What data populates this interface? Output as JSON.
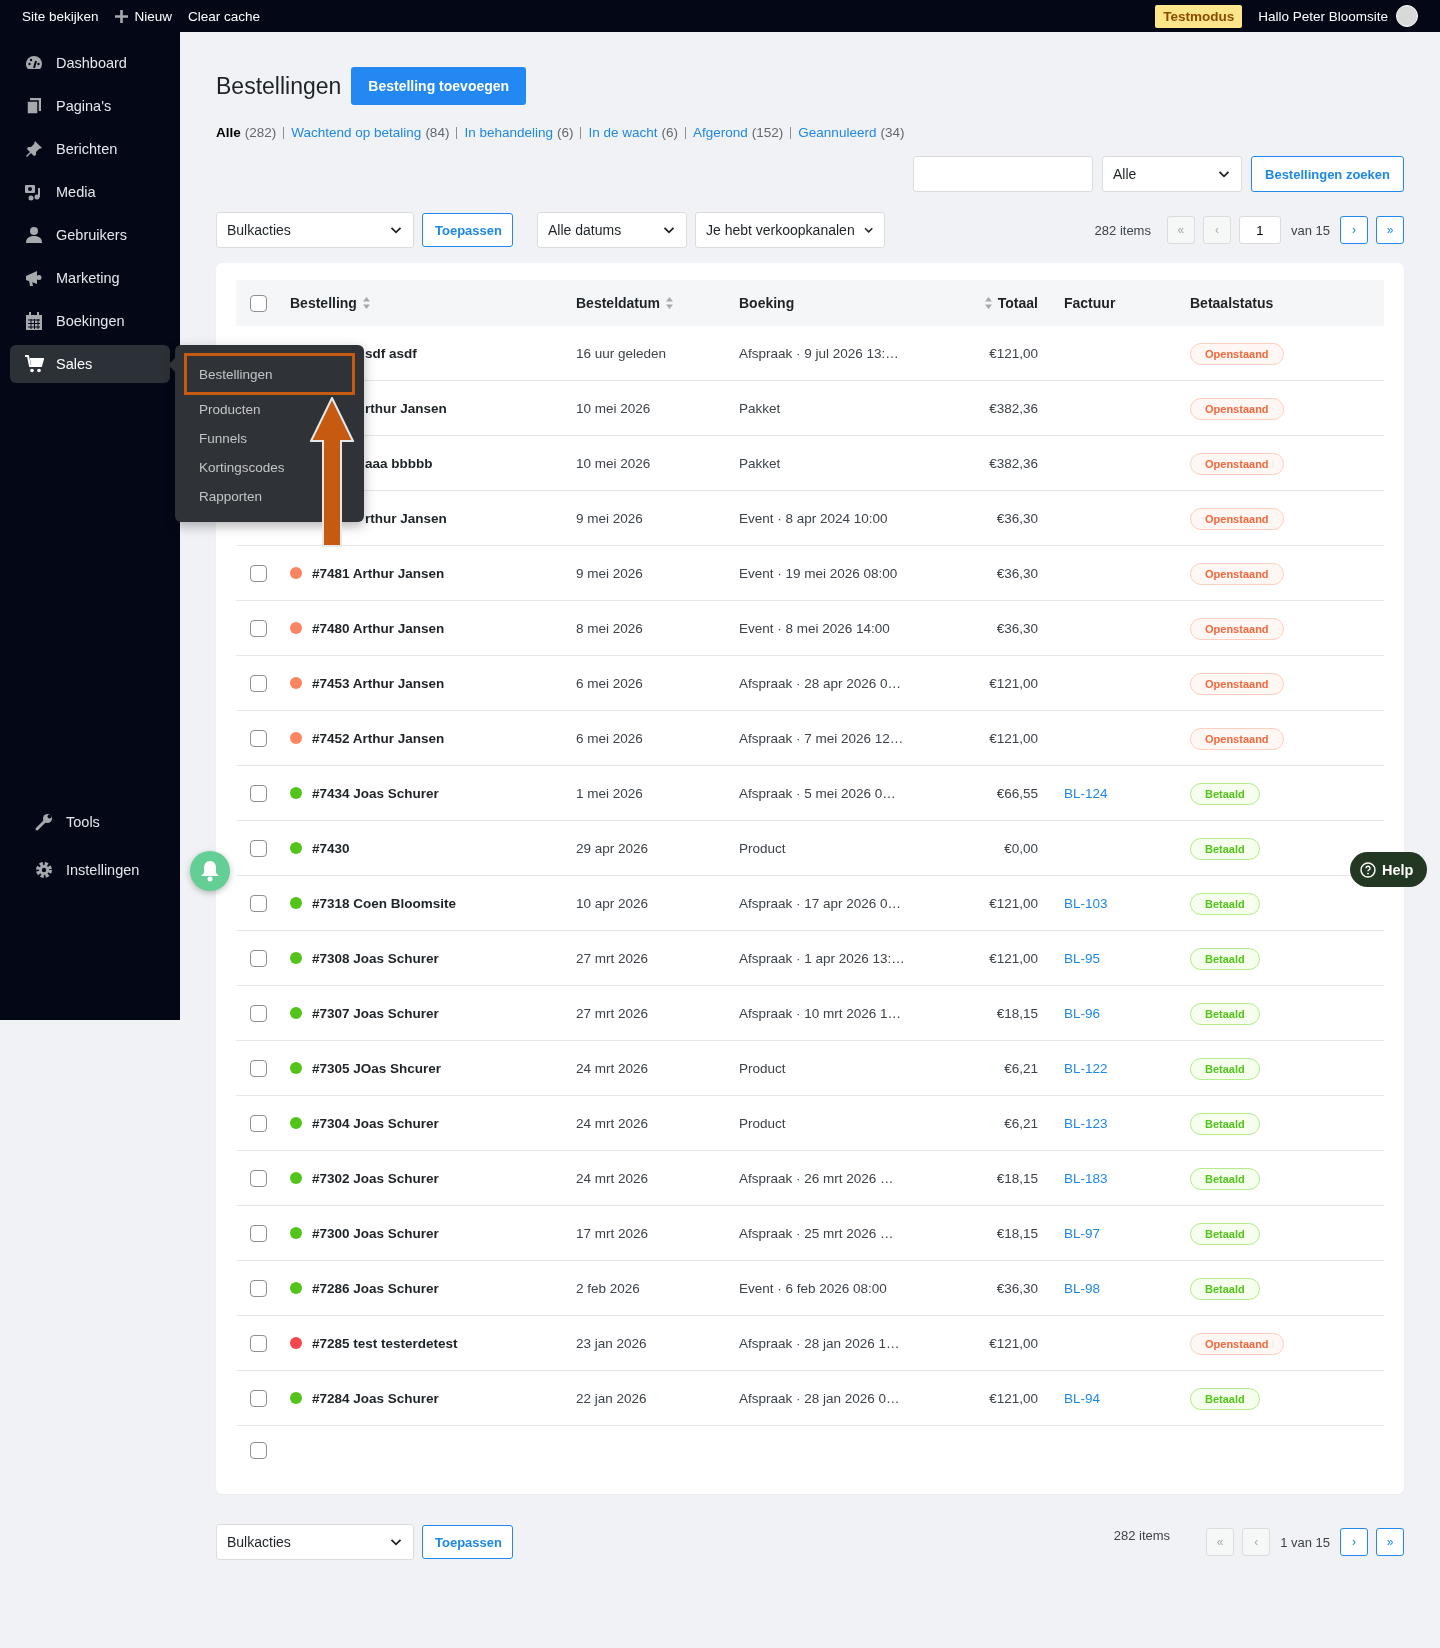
{
  "topbar": {
    "items": [
      {
        "label": "Site bekijken",
        "kind": "text"
      },
      {
        "label": "Nieuw",
        "kind": "new"
      },
      {
        "label": "Clear cache",
        "kind": "text"
      }
    ],
    "badge": "Testmodus",
    "greeting": "Hallo Peter Bloomsite"
  },
  "sidebar": {
    "items": [
      {
        "label": "Dashboard",
        "kind": "dashboard",
        "selected": false
      },
      {
        "label": "Pagina's",
        "kind": "pages",
        "selected": false
      },
      {
        "label": "Berichten",
        "kind": "pin",
        "selected": false
      },
      {
        "label": "Media",
        "kind": "media",
        "selected": false
      },
      {
        "label": "Gebruikers",
        "kind": "user",
        "selected": false
      },
      {
        "label": "Marketing",
        "kind": "megaphone",
        "selected": false
      },
      {
        "label": "Boekingen",
        "kind": "calendar",
        "selected": false
      },
      {
        "label": "Sales",
        "kind": "cart",
        "selected": true
      }
    ],
    "footer_items": [
      {
        "label": "Tools",
        "kind": "wrench"
      },
      {
        "label": "Instellingen",
        "kind": "gear"
      }
    ]
  },
  "submenu": {
    "items": [
      {
        "label": "Bestellingen",
        "highlighted": true
      },
      {
        "label": "Producten",
        "highlighted": false
      },
      {
        "label": "Funnels",
        "highlighted": false
      },
      {
        "label": "Kortingscodes",
        "highlighted": false
      },
      {
        "label": "Rapporten",
        "highlighted": false
      }
    ]
  },
  "page": {
    "title": "Bestellingen",
    "add_button": "Bestelling toevoegen"
  },
  "status_filters": [
    {
      "label": "Alle",
      "count": "(282)",
      "selected": true
    },
    {
      "label": "Wachtend op betaling",
      "count": "(84)",
      "selected": false
    },
    {
      "label": "In behandeling",
      "count": "(6)",
      "selected": false
    },
    {
      "label": "In de wacht",
      "count": "(6)",
      "selected": false
    },
    {
      "label": "Afgerond",
      "count": "(152)",
      "selected": false
    },
    {
      "label": "Geannuleerd",
      "count": "(34)",
      "selected": false
    }
  ],
  "search": {
    "select": "Alle",
    "button": "Bestellingen zoeken"
  },
  "toolbar": {
    "bulk": "Bulkacties",
    "apply": "Toepassen",
    "dates": "Alle datums",
    "channels": "Je hebt verkoopkanalen"
  },
  "pagination": {
    "count": "282 items",
    "buttons": [
      {
        "label": "«",
        "disabled": true
      },
      {
        "label": "‹",
        "disabled": true
      },
      {
        "label": "›",
        "disabled": false
      },
      {
        "label": "»",
        "disabled": false
      }
    ],
    "page": "1",
    "of": "van 15"
  },
  "table": {
    "select_all": false,
    "columns": [
      {
        "label": "Bestelling",
        "sortable": true
      },
      {
        "label": "Besteldatum",
        "sortable": true
      },
      {
        "label": "Boeking",
        "sortable": false
      },
      {
        "label": "Totaal",
        "sortable": true
      },
      {
        "label": "Factuur",
        "sortable": false
      },
      {
        "label": "Betaalstatus",
        "sortable": false
      }
    ],
    "rows": [
      {
        "covered": true,
        "order": "sdf asdf",
        "date": "16 uur geleden",
        "booking": "Afspraak · 9 jul 2026 13:…",
        "total": "€121,00",
        "status": {
          "label": "Openstaand",
          "kind": "open"
        }
      },
      {
        "covered": true,
        "order": "rthur Jansen",
        "date": "10 mei 2026",
        "booking": "Pakket",
        "total": "€382,36",
        "status": {
          "label": "Openstaand",
          "kind": "open"
        }
      },
      {
        "covered": true,
        "order": "aaa bbbbb",
        "date": "10 mei 2026",
        "booking": "Pakket",
        "total": "€382,36",
        "status": {
          "label": "Openstaand",
          "kind": "open"
        }
      },
      {
        "covered": true,
        "order": "rthur Jansen",
        "date": "9 mei 2026",
        "booking": "Event · 8 apr 2024 10:00",
        "total": "€36,30",
        "status": {
          "label": "Openstaand",
          "kind": "open"
        }
      },
      {
        "checked": false,
        "color": "#fa8560",
        "order": "#7481 Arthur Jansen",
        "date": "9 mei 2026",
        "booking": "Event · 19 mei 2026 08:00",
        "total": "€36,30",
        "status": {
          "label": "Openstaand",
          "kind": "open"
        }
      },
      {
        "checked": false,
        "color": "#fa8560",
        "order": "#7480 Arthur Jansen",
        "date": "8 mei 2026",
        "booking": "Event · 8 mei 2026 14:00",
        "total": "€36,30",
        "status": {
          "label": "Openstaand",
          "kind": "open"
        }
      },
      {
        "checked": false,
        "color": "#fa8560",
        "order": "#7453 Arthur Jansen",
        "date": "6 mei 2026",
        "booking": "Afspraak · 28 apr 2026 0…",
        "total": "€121,00",
        "status": {
          "label": "Openstaand",
          "kind": "open"
        }
      },
      {
        "checked": false,
        "color": "#fa8560",
        "order": "#7452 Arthur Jansen",
        "date": "6 mei 2026",
        "booking": "Afspraak · 7 mei 2026 12…",
        "total": "€121,00",
        "status": {
          "label": "Openstaand",
          "kind": "open"
        }
      },
      {
        "checked": false,
        "color": "#52c41a",
        "order": "#7434 Joas Schurer",
        "date": "1 mei 2026",
        "booking": "Afspraak · 5 mei 2026 0…",
        "total": "€66,55",
        "invoice": "BL-124",
        "status": {
          "label": "Betaald",
          "kind": "paid"
        }
      },
      {
        "checked": false,
        "color": "#52c41a",
        "order": "#7430",
        "date": "29 apr 2026",
        "booking": "Product",
        "total": "€0,00",
        "status": {
          "label": "Betaald",
          "kind": "paid"
        }
      },
      {
        "checked": false,
        "color": "#52c41a",
        "order": "#7318 Coen Bloomsite",
        "date": "10 apr 2026",
        "booking": "Afspraak · 17 apr 2026 0…",
        "total": "€121,00",
        "invoice": "BL-103",
        "status": {
          "label": "Betaald",
          "kind": "paid"
        }
      },
      {
        "checked": false,
        "color": "#52c41a",
        "order": "#7308 Joas Schurer",
        "date": "27 mrt 2026",
        "booking": "Afspraak · 1 apr 2026 13:…",
        "total": "€121,00",
        "invoice": "BL-95",
        "status": {
          "label": "Betaald",
          "kind": "paid"
        }
      },
      {
        "checked": false,
        "color": "#52c41a",
        "order": "#7307 Joas Schurer",
        "date": "27 mrt 2026",
        "booking": "Afspraak · 10 mrt 2026 1…",
        "total": "€18,15",
        "invoice": "BL-96",
        "status": {
          "label": "Betaald",
          "kind": "paid"
        }
      },
      {
        "checked": false,
        "color": "#52c41a",
        "order": "#7305 JOas Shcurer",
        "date": "24 mrt 2026",
        "booking": "Product",
        "total": "€6,21",
        "invoice": "BL-122",
        "status": {
          "label": "Betaald",
          "kind": "paid"
        }
      },
      {
        "checked": false,
        "color": "#52c41a",
        "order": "#7304 Joas Schurer",
        "date": "24 mrt 2026",
        "booking": "Product",
        "total": "€6,21",
        "invoice": "BL-123",
        "status": {
          "label": "Betaald",
          "kind": "paid"
        }
      },
      {
        "checked": false,
        "color": "#52c41a",
        "order": "#7302 Joas Schurer",
        "date": "24 mrt 2026",
        "booking": "Afspraak · 26 mrt 2026 …",
        "total": "€18,15",
        "invoice": "BL-183",
        "status": {
          "label": "Betaald",
          "kind": "paid"
        }
      },
      {
        "checked": false,
        "color": "#52c41a",
        "order": "#7300 Joas Schurer",
        "date": "17 mrt 2026",
        "booking": "Afspraak · 25 mrt 2026 …",
        "total": "€18,15",
        "invoice": "BL-97",
        "status": {
          "label": "Betaald",
          "kind": "paid"
        }
      },
      {
        "checked": false,
        "color": "#52c41a",
        "order": "#7286 Joas Schurer",
        "date": "2 feb 2026",
        "booking": "Event · 6 feb 2026 08:00",
        "total": "€36,30",
        "invoice": "BL-98",
        "status": {
          "label": "Betaald",
          "kind": "paid"
        }
      },
      {
        "checked": false,
        "color": "#f5464f",
        "order": "#7285 test testerdetest",
        "date": "23 jan 2026",
        "booking": "Afspraak · 28 jan 2026 1…",
        "total": "€121,00",
        "status": {
          "label": "Openstaand",
          "kind": "open"
        }
      },
      {
        "checked": false,
        "color": "#52c41a",
        "order": "#7284 Joas Schurer",
        "date": "22 jan 2026",
        "booking": "Afspraak · 28 jan 2026 0…",
        "total": "€121,00",
        "invoice": "BL-94",
        "status": {
          "label": "Betaald",
          "kind": "paid"
        }
      },
      {
        "checked": false
      }
    ]
  },
  "bottom": {
    "bulk": "Bulkacties",
    "apply": "Toepassen",
    "count": "282 items",
    "buttons": [
      {
        "label": "«",
        "disabled": true
      },
      {
        "label": "‹",
        "disabled": true
      },
      {
        "label": "›",
        "disabled": false
      },
      {
        "label": "»",
        "disabled": false
      }
    ],
    "page_info": "1 van 15"
  },
  "help": "Help"
}
